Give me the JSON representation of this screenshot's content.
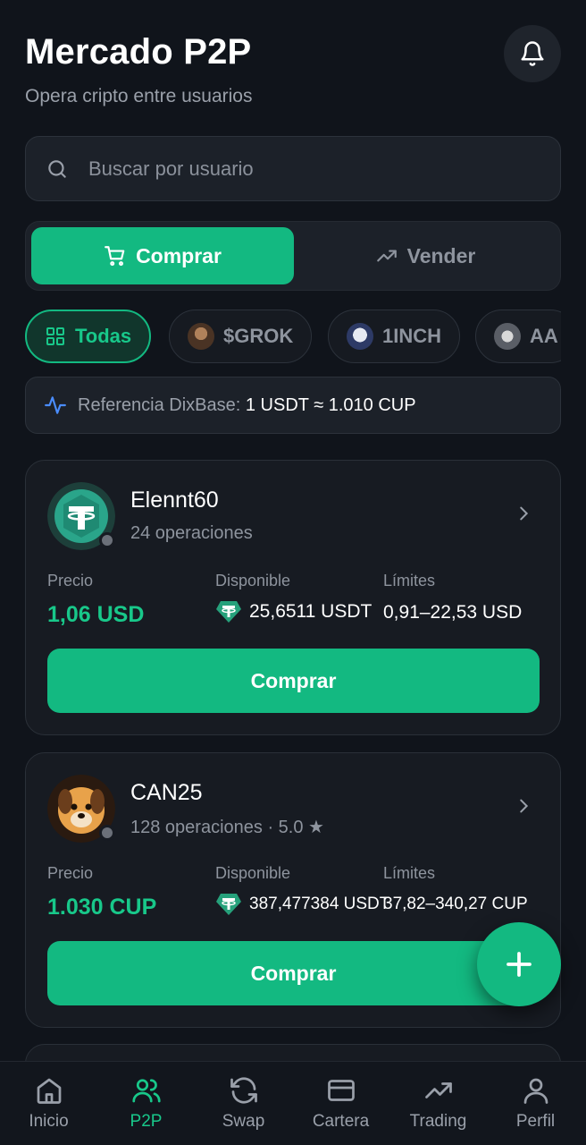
{
  "header": {
    "title": "Mercado P2P",
    "subtitle": "Opera cripto entre usuarios",
    "bell_icon": "bell-icon"
  },
  "search": {
    "placeholder": "Buscar por usuario"
  },
  "segment": {
    "buy_label": "Comprar",
    "sell_label": "Vender",
    "selected": "Comprar"
  },
  "chips": [
    {
      "label": "Todas",
      "icon": "grid-icon",
      "active": true
    },
    {
      "label": "$GROK",
      "icon": "grok-coin-icon",
      "active": false
    },
    {
      "label": "1INCH",
      "icon": "1inch-coin-icon",
      "active": false
    },
    {
      "label": "AA",
      "icon": "apple-coin-icon",
      "active": false
    }
  ],
  "reference": {
    "label": "Referencia DixBase:",
    "value": "1 USDT ≈ 1.010 CUP"
  },
  "offers": [
    {
      "user": "Elennt60",
      "operations": "24 operaciones",
      "price_label": "Precio",
      "available_label": "Disponible",
      "limits_label": "Límites",
      "price": "1,06 USD",
      "available": "25,6511 USDT",
      "limits": "0,91–22,53 USD",
      "button": "Comprar"
    },
    {
      "user": "CAN25",
      "operations": "128 operaciones · 5.0 ★",
      "price_label": "Precio",
      "available_label": "Disponible",
      "limits_label": "Límites",
      "price": "1.030 CUP",
      "available": "387,477384 USDT",
      "limits": "37,82–340,27 CUP",
      "button": "Comprar"
    }
  ],
  "nav": [
    {
      "label": "Inicio",
      "icon": "home-icon",
      "active": false
    },
    {
      "label": "P2P",
      "icon": "users-icon",
      "active": true
    },
    {
      "label": "Swap",
      "icon": "refresh-icon",
      "active": false
    },
    {
      "label": "Cartera",
      "icon": "wallet-icon",
      "active": false
    },
    {
      "label": "Trading",
      "icon": "trending-up-icon",
      "active": false
    },
    {
      "label": "Perfil",
      "icon": "user-icon",
      "active": false
    }
  ],
  "colors": {
    "accent": "#13b981",
    "background": "#10141b",
    "card": "#171b22"
  }
}
